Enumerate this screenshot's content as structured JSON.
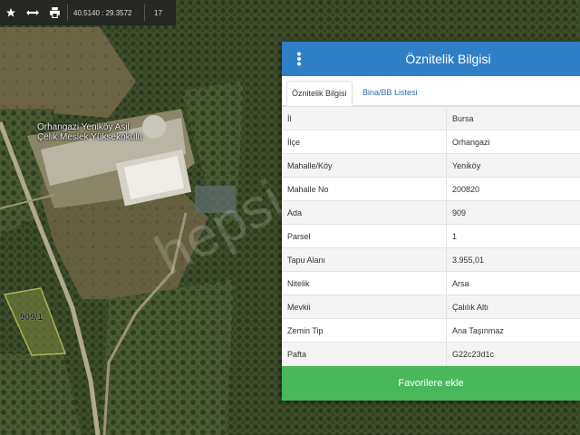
{
  "toolbar": {
    "buttons": [
      {
        "icon": "star-icon"
      },
      {
        "icon": "measure-arrows-icon"
      },
      {
        "icon": "print-icon"
      }
    ],
    "coordinates": "40.5140 : 29.3572",
    "zoom": "17"
  },
  "map": {
    "place_label_line1": "Orhangazi Yeniköy Asil",
    "place_label_line2": "Çelik Meslek Yüksekokulu",
    "parcel_label": "909/1",
    "watermark": "hepsi"
  },
  "panel": {
    "title": "Öznitelik Bilgisi",
    "menu_icon": "vertical-dots-icon",
    "tabs": [
      "Öznitelik Bilgisi",
      "Bina/BB Listesi"
    ],
    "attributes": [
      {
        "key": "İl",
        "value": "Bursa"
      },
      {
        "key": "İlçe",
        "value": "Orhangazi"
      },
      {
        "key": "Mahalle/Köy",
        "value": "Yeniköy"
      },
      {
        "key": "Mahalle No",
        "value": "200820"
      },
      {
        "key": "Ada",
        "value": "909"
      },
      {
        "key": "Parsel",
        "value": "1"
      },
      {
        "key": "Tapu Alanı",
        "value": "3.955,01"
      },
      {
        "key": "Nitelik",
        "value": "Arsa"
      },
      {
        "key": "Mevkii",
        "value": "Çalılık Altı"
      },
      {
        "key": "Zemin Tip",
        "value": "Ana Taşınmaz"
      },
      {
        "key": "Pafta",
        "value": "G22c23d1c"
      }
    ],
    "favorite_button": "Favorilere ekle"
  },
  "colors": {
    "header": "#2f7fc6",
    "favorite": "#48b85a",
    "tab_link": "#2f6fae"
  }
}
